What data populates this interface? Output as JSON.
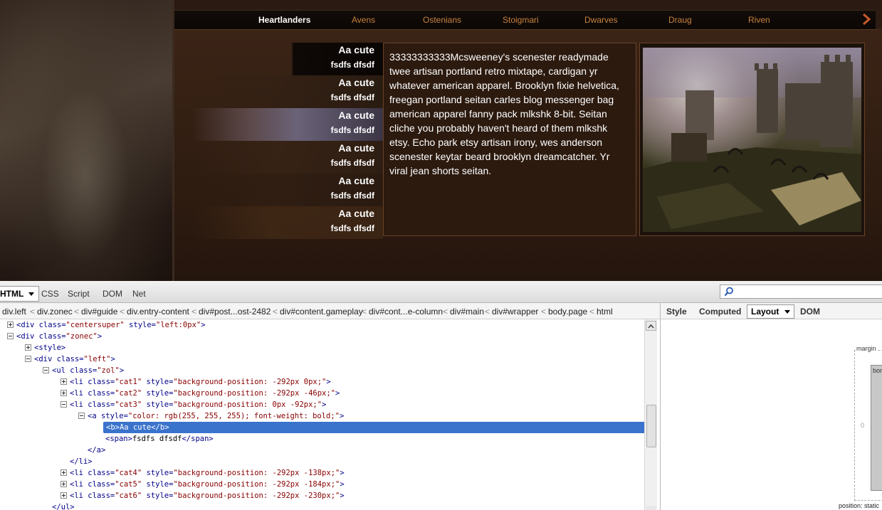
{
  "site": {
    "nav": {
      "items": [
        "Heartlanders",
        "Avens",
        "Ostenians",
        "Stoigmari",
        "Dwarves",
        "Draug",
        "Riven"
      ],
      "active_index": 0,
      "accent_color": "#c8823f"
    },
    "categories": [
      {
        "title": "Aa cute",
        "sub": "fsdfs dfsdf"
      },
      {
        "title": "Aa cute",
        "sub": "fsdfs dfsdf"
      },
      {
        "title": "Aa cute",
        "sub": "fsdfs dfsdf"
      },
      {
        "title": "Aa cute",
        "sub": "fsdfs dfsdf"
      },
      {
        "title": "Aa cute",
        "sub": "fsdfs dfsdf"
      },
      {
        "title": "Aa cute",
        "sub": "fsdfs dfsdf"
      }
    ],
    "description": "33333333333Mcsweeney's scenester readymade twee artisan portland retro mixtape, cardigan yr whatever american apparel. Brooklyn fixie helvetica, freegan portland seitan carles blog messenger bag american apparel fanny pack mlkshk 8-bit. Seitan cliche you probably haven't heard of them mlkshk etsy. Echo park etsy artisan irony, wes anderson scenester keytar beard brooklyn dreamcatcher. Yr viral jean shorts seitan."
  },
  "devtools": {
    "tabs": [
      "HTML",
      "CSS",
      "Script",
      "DOM",
      "Net"
    ],
    "selected_tab": "HTML",
    "breadcrumbs": [
      "div.left",
      "div.zonec",
      "div#guide",
      "div.entry-content",
      "div#post...ost-2482",
      "div#content.gameplay",
      "div#cont...e-column",
      "div#main",
      "div#wrapper",
      "body.page",
      "html"
    ],
    "side_tabs": [
      "Style",
      "Computed",
      "Layout",
      "DOM"
    ],
    "selected_side_tab": "Layout",
    "layout": {
      "margin_label": "margin",
      "border_label": "bord",
      "zero": "0",
      "position": "position: static"
    },
    "tree": [
      {
        "indent": 0,
        "toggle": "plus",
        "parts": [
          [
            "t",
            "<div "
          ],
          [
            "a",
            "class="
          ],
          [
            "v",
            "\"centersuper\""
          ],
          [
            "a",
            " style="
          ],
          [
            "v",
            "\"left:0px\""
          ],
          [
            "t",
            ">"
          ]
        ]
      },
      {
        "indent": 0,
        "toggle": "minus",
        "parts": [
          [
            "t",
            "<div "
          ],
          [
            "a",
            "class="
          ],
          [
            "v",
            "\"zonec\""
          ],
          [
            "t",
            ">"
          ]
        ]
      },
      {
        "indent": 1,
        "toggle": "plus",
        "parts": [
          [
            "t",
            "<style>"
          ]
        ]
      },
      {
        "indent": 1,
        "toggle": "minus",
        "parts": [
          [
            "t",
            "<div "
          ],
          [
            "a",
            "class="
          ],
          [
            "v",
            "\"left\""
          ],
          [
            "t",
            ">"
          ]
        ]
      },
      {
        "indent": 2,
        "toggle": "minus",
        "parts": [
          [
            "t",
            "<ul "
          ],
          [
            "a",
            "class="
          ],
          [
            "v",
            "\"zol\""
          ],
          [
            "t",
            ">"
          ]
        ]
      },
      {
        "indent": 3,
        "toggle": "plus",
        "parts": [
          [
            "t",
            "<li "
          ],
          [
            "a",
            "class="
          ],
          [
            "v",
            "\"cat1\""
          ],
          [
            "a",
            " style="
          ],
          [
            "v",
            "\"background-position: -292px 0px;\""
          ],
          [
            "t",
            ">"
          ]
        ]
      },
      {
        "indent": 3,
        "toggle": "plus",
        "parts": [
          [
            "t",
            "<li "
          ],
          [
            "a",
            "class="
          ],
          [
            "v",
            "\"cat2\""
          ],
          [
            "a",
            " style="
          ],
          [
            "v",
            "\"background-position: -292px -46px;\""
          ],
          [
            "t",
            ">"
          ]
        ]
      },
      {
        "indent": 3,
        "toggle": "minus",
        "parts": [
          [
            "t",
            "<li "
          ],
          [
            "a",
            "class="
          ],
          [
            "v",
            "\"cat3\""
          ],
          [
            "a",
            " style="
          ],
          [
            "v",
            "\"background-position: 0px -92px;\""
          ],
          [
            "t",
            ">"
          ]
        ]
      },
      {
        "indent": 4,
        "toggle": "minus",
        "parts": [
          [
            "t",
            "<a "
          ],
          [
            "a",
            "style="
          ],
          [
            "v",
            "\"color: rgb(255, 255, 255); font-weight: bold;\""
          ],
          [
            "t",
            ">"
          ]
        ]
      },
      {
        "indent": 5,
        "toggle": "none",
        "selected": true,
        "parts": [
          [
            "t",
            "<b>"
          ],
          [
            "x",
            "Aa cute"
          ],
          [
            "t",
            "</b>"
          ]
        ]
      },
      {
        "indent": 5,
        "toggle": "none",
        "parts": [
          [
            "t",
            "<span>"
          ],
          [
            "x",
            "fsdfs dfsdf"
          ],
          [
            "t",
            "</span>"
          ]
        ]
      },
      {
        "indent": 4,
        "toggle": "none",
        "parts": [
          [
            "t",
            "</a>"
          ]
        ]
      },
      {
        "indent": 3,
        "toggle": "none",
        "parts": [
          [
            "t",
            "</li>"
          ]
        ]
      },
      {
        "indent": 3,
        "toggle": "plus",
        "parts": [
          [
            "t",
            "<li "
          ],
          [
            "a",
            "class="
          ],
          [
            "v",
            "\"cat4\""
          ],
          [
            "a",
            " style="
          ],
          [
            "v",
            "\"background-position: -292px -138px;\""
          ],
          [
            "t",
            ">"
          ]
        ]
      },
      {
        "indent": 3,
        "toggle": "plus",
        "parts": [
          [
            "t",
            "<li "
          ],
          [
            "a",
            "class="
          ],
          [
            "v",
            "\"cat5\""
          ],
          [
            "a",
            " style="
          ],
          [
            "v",
            "\"background-position: -292px -184px;\""
          ],
          [
            "t",
            ">"
          ]
        ]
      },
      {
        "indent": 3,
        "toggle": "plus",
        "parts": [
          [
            "t",
            "<li "
          ],
          [
            "a",
            "class="
          ],
          [
            "v",
            "\"cat6\""
          ],
          [
            "a",
            " style="
          ],
          [
            "v",
            "\"background-position: -292px -230px;\""
          ],
          [
            "t",
            ">"
          ]
        ]
      },
      {
        "indent": 2,
        "toggle": "none",
        "parts": [
          [
            "t",
            "</ul>"
          ]
        ]
      }
    ]
  }
}
